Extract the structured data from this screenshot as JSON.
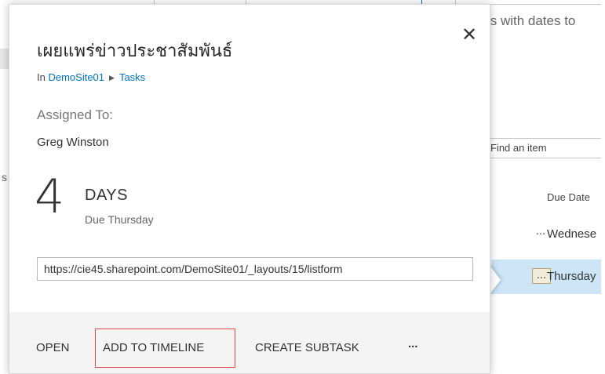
{
  "background": {
    "hint_text": "ts with dates to",
    "search_placeholder": "Find an item",
    "side_letter": "s",
    "column_header": "Due Date",
    "rows": [
      {
        "ellipsis": "...",
        "label": "Wednese"
      },
      {
        "ellipsis": "...",
        "label": "Thursday"
      }
    ]
  },
  "callout": {
    "close_glyph": "✕",
    "title": "เผยแพร่ข่าวประชาสัมพันธ์",
    "breadcrumb": {
      "prefix": "In ",
      "site": "DemoSite01",
      "separator": "▶",
      "list": "Tasks"
    },
    "assigned_label": "Assigned To:",
    "assigned_value": "Greg Winston",
    "days_number": "4",
    "days_label": "DAYS",
    "due_text": "Due Thursday",
    "url": "https://cie45.sharepoint.com/DemoSite01/_layouts/15/listform",
    "actions": {
      "open": "OPEN",
      "add_to_timeline": "ADD TO TIMELINE",
      "create_subtask": "CREATE SUBTASK",
      "more": "..."
    }
  },
  "colors": {
    "accent": "#0072c6",
    "highlight_border": "#e04848",
    "selected_row": "#cde6f7"
  }
}
